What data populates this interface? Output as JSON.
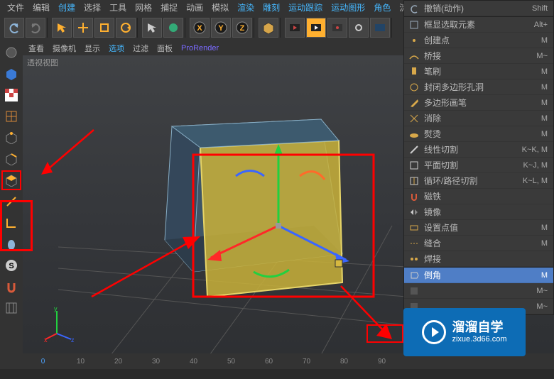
{
  "menubar": [
    "文件",
    "编辑",
    "创建",
    "选择",
    "工具",
    "网格",
    "捕捉",
    "动画",
    "模拟",
    "渲染",
    "雕刻",
    "运动跟踪",
    "运动图形",
    "角色",
    "流"
  ],
  "toolbar": {
    "groups": [
      {
        "name": "undo",
        "items": [
          {
            "n": "undo-icon"
          },
          {
            "n": "redo-icon"
          }
        ]
      },
      {
        "name": "transform",
        "items": [
          {
            "n": "arrow-icon"
          },
          {
            "n": "move-icon"
          },
          {
            "n": "scale-icon"
          },
          {
            "n": "rotate-icon"
          }
        ]
      },
      {
        "name": "select",
        "items": [
          {
            "n": "pick-icon"
          },
          {
            "n": "live-icon"
          }
        ]
      },
      {
        "name": "axis",
        "items": [
          {
            "n": "x-icon",
            "label": "X"
          },
          {
            "n": "y-icon",
            "label": "Y"
          },
          {
            "n": "z-icon",
            "label": "Z"
          }
        ]
      },
      {
        "name": "cube",
        "items": [
          {
            "n": "prim-cube-icon"
          }
        ]
      },
      {
        "name": "render",
        "items": [
          {
            "n": "render-icon"
          },
          {
            "n": "preview-icon"
          },
          {
            "n": "render-out-icon"
          },
          {
            "n": "settings-icon"
          },
          {
            "n": "take-icon"
          }
        ]
      }
    ]
  },
  "left_tools": [
    {
      "n": "model-icon"
    },
    {
      "n": "tex-icon"
    },
    {
      "n": "checker-icon"
    },
    {
      "n": "grid-icon"
    },
    {
      "n": "point-icon"
    },
    {
      "n": "edge-icon"
    },
    {
      "n": "poly-icon",
      "hl": true
    },
    {
      "n": "axis-icon"
    },
    {
      "n": "corner-icon"
    },
    {
      "n": "mouse-icon"
    },
    {
      "n": "s-icon"
    },
    {
      "n": "magnet-icon"
    },
    {
      "n": "mesh-icon"
    }
  ],
  "viewport": {
    "tabs": [
      "查看",
      "摄像机",
      "显示",
      "选项",
      "过滤",
      "面板",
      "ProRender"
    ],
    "title": "透视视图",
    "selected_tab": 3
  },
  "context_menu": [
    {
      "label": "撤销(动作)",
      "shortcut": "Shift",
      "icon": "undo"
    },
    {
      "label": "框显选取元素",
      "shortcut": "Alt+",
      "icon": "frame"
    },
    {
      "label": "创建点",
      "shortcut": "M",
      "icon": "point"
    },
    {
      "label": "桥接",
      "shortcut": "M~",
      "icon": "bridge"
    },
    {
      "label": "笔刷",
      "shortcut": "M",
      "icon": "brush"
    },
    {
      "label": "封闭多边形孔洞",
      "shortcut": "M",
      "icon": "close-hole"
    },
    {
      "label": "多边形画笔",
      "shortcut": "M",
      "icon": "poly-pen"
    },
    {
      "label": "消除",
      "shortcut": "M",
      "icon": "dissolve"
    },
    {
      "label": "熨烫",
      "shortcut": "M",
      "icon": "iron"
    },
    {
      "label": "线性切割",
      "shortcut": "K~K, M",
      "icon": "knife"
    },
    {
      "label": "平面切割",
      "shortcut": "K~J, M",
      "icon": "plane-cut"
    },
    {
      "label": "循环/路径切割",
      "shortcut": "K~L, M",
      "icon": "loop-cut"
    },
    {
      "label": "磁铁",
      "shortcut": "",
      "icon": "magnet"
    },
    {
      "label": "镜像",
      "shortcut": "",
      "icon": "mirror"
    },
    {
      "label": "设置点值",
      "shortcut": "M",
      "icon": "set-point"
    },
    {
      "label": "缝合",
      "shortcut": "M",
      "icon": "stitch"
    },
    {
      "label": "焊接",
      "shortcut": "",
      "icon": "weld"
    },
    {
      "label": "倒角",
      "shortcut": "M",
      "icon": "bevel",
      "hl": true
    },
    {
      "label": "",
      "shortcut": "M~",
      "icon": "sub",
      "covered": true
    },
    {
      "label": "",
      "shortcut": "M~",
      "icon": "sub2",
      "covered": true
    }
  ],
  "timeline": {
    "ticks": [
      "0",
      "10",
      "20",
      "30",
      "40",
      "50",
      "60",
      "70",
      "80",
      "90"
    ],
    "active": 0
  },
  "watermark": {
    "cn": "溜溜自学",
    "url": "zixue.3d66.com"
  },
  "axis_gizmo": {
    "x": "x",
    "y": "y",
    "z": "z"
  }
}
